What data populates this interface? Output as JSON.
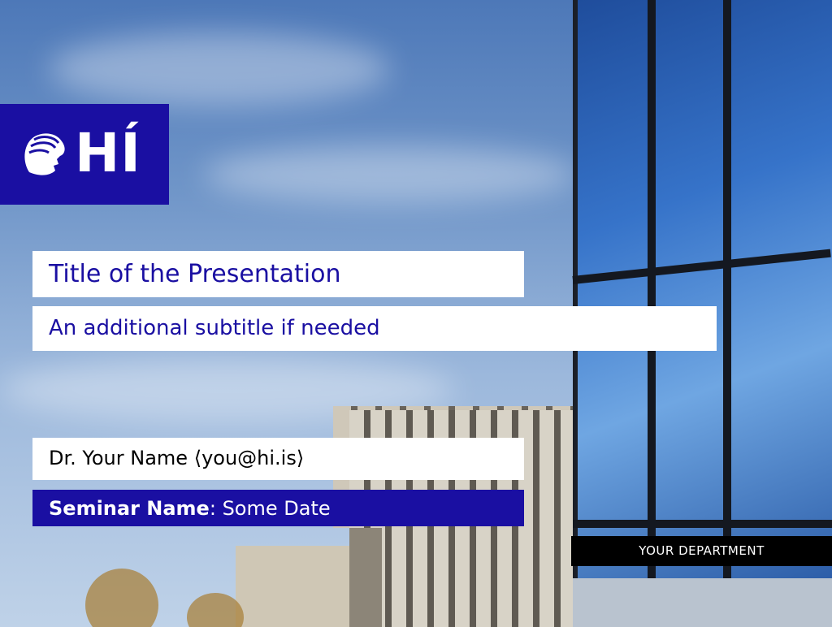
{
  "logo": {
    "text": "HÍ",
    "icon": "helmeted-head-icon"
  },
  "title": "Title of the Presentation",
  "subtitle": "An additional subtitle if needed",
  "author": "Dr. Your Name ⟨you@hi.is⟩",
  "seminar": {
    "name": "Seminar Name",
    "separator": ":",
    "date": " Some Date"
  },
  "department": "YOUR DEPARTMENT",
  "colors": {
    "brand": "#1a0fa2",
    "box": "#ffffff",
    "department_bg": "#000000"
  }
}
